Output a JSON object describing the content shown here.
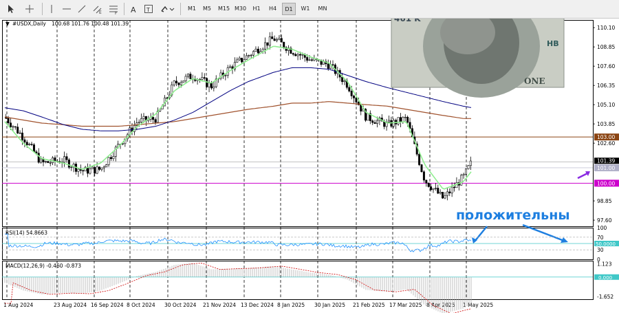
{
  "toolbar": {
    "icons": [
      "cursor-icon",
      "crosshair-icon",
      "vertical-line-icon",
      "horizontal-line-icon",
      "trendline-icon",
      "equidistant-channel-icon",
      "fibonacci-icon",
      "text-icon",
      "text-label-icon",
      "arrows-icon"
    ],
    "timeframes": [
      "M1",
      "M5",
      "M15",
      "M30",
      "H1",
      "H4",
      "D1",
      "W1",
      "MN"
    ],
    "selected_timeframe": "D1"
  },
  "chart_header": {
    "symbol": "#USDX,Daily",
    "ohlc": "100.68 101.76 100.48 101.39"
  },
  "price_axis": {
    "ticks": [
      "110.10",
      "108.85",
      "107.60",
      "106.35",
      "105.10",
      "103.85",
      "102.60",
      "98.85",
      "97.60"
    ]
  },
  "levels": {
    "resistance": "103.00",
    "current": "101.39",
    "level_101": "101.00",
    "support": "100.00"
  },
  "annotation": {
    "text": "положительны"
  },
  "rsi": {
    "label": "RSI(14) 54.8663",
    "ticks": [
      "100",
      "70",
      "30",
      "0"
    ],
    "level": "50.0000"
  },
  "macd": {
    "label": "MACD(12,26,9) -0.460 -0.873",
    "ticks": [
      "1.123",
      "-1.652"
    ],
    "zero": "0.000"
  },
  "time_axis": [
    "1 Aug 2024",
    "23 Aug 2024",
    "16 Sep 2024",
    "8 Oct 2024",
    "30 Oct 2024",
    "21 Nov 2024",
    "13 Dec 2024",
    "8 Jan 2025",
    "30 Jan 2025",
    "21 Feb 2025",
    "17 Mar 2025",
    "8 Apr 2025",
    "1 May 2025"
  ],
  "banknote": {
    "serial": "461 K",
    "series": "HB",
    "word": "ONE"
  },
  "colors": {
    "candles": "#000000",
    "ma_fast": "#90EE90",
    "ma_mid": "#000080",
    "ma_slow": "#A0522D",
    "resistance": "#8B4513",
    "support": "#CC00CC",
    "rsi": "#1E90FF",
    "annotation": "#1E7FE0",
    "arrow_price": "#8A2BE2"
  },
  "chart_data": {
    "type": "candlestick",
    "x": [
      "2024-08-01",
      "2024-08-12",
      "2024-08-23",
      "2024-09-05",
      "2024-09-16",
      "2024-09-27",
      "2024-10-08",
      "2024-10-19",
      "2024-10-30",
      "2024-11-10",
      "2024-11-21",
      "2024-12-02",
      "2024-12-13",
      "2024-12-24",
      "2025-01-08",
      "2025-01-19",
      "2025-01-30",
      "2025-02-10",
      "2025-02-21",
      "2025-03-04",
      "2025-03-17",
      "2025-03-28",
      "2025-04-08",
      "2025-04-19",
      "2025-05-01",
      "2025-05-06"
    ],
    "close": [
      104.3,
      103.0,
      101.3,
      101.5,
      100.8,
      100.9,
      102.5,
      104.0,
      104.2,
      106.5,
      107.0,
      106.3,
      107.5,
      108.3,
      109.4,
      108.6,
      108.0,
      107.7,
      106.4,
      104.3,
      103.8,
      104.2,
      100.2,
      99.0,
      100.4,
      101.39
    ],
    "ylim": [
      97.2,
      110.6
    ],
    "ma_fast": [
      104.0,
      102.6,
      101.6,
      101.3,
      100.9,
      101.3,
      102.4,
      103.7,
      104.5,
      106.0,
      106.8,
      106.5,
      107.3,
      108.0,
      108.9,
      108.7,
      108.2,
      107.8,
      106.6,
      104.6,
      103.9,
      104.0,
      101.2,
      99.6,
      100.1,
      100.8
    ],
    "ma_mid": [
      104.9,
      104.7,
      104.3,
      103.8,
      103.5,
      103.4,
      103.4,
      103.5,
      103.7,
      104.1,
      104.6,
      105.3,
      106.0,
      106.6,
      107.2,
      107.5,
      107.5,
      107.4,
      107.0,
      106.6,
      106.2,
      105.9,
      105.6,
      105.3,
      105.0,
      104.9
    ],
    "ma_slow": [
      104.3,
      104.1,
      103.9,
      103.8,
      103.7,
      103.7,
      103.7,
      103.8,
      103.9,
      104.0,
      104.2,
      104.4,
      104.6,
      104.8,
      105.0,
      105.2,
      105.2,
      105.3,
      105.2,
      105.1,
      105.0,
      104.8,
      104.6,
      104.4,
      104.2,
      104.2
    ],
    "horizontal_levels": [
      103.0,
      101.0,
      100.0
    ]
  }
}
